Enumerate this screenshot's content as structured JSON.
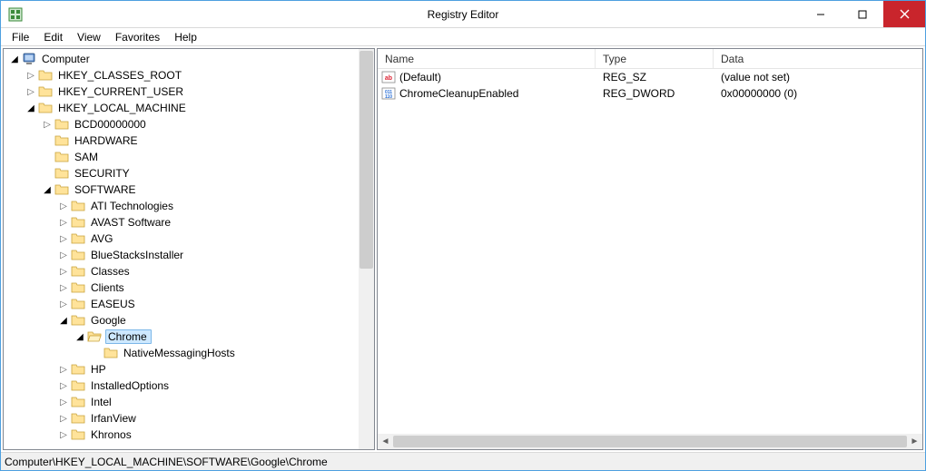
{
  "window": {
    "title": "Registry Editor"
  },
  "menu": {
    "file": "File",
    "edit": "Edit",
    "view": "View",
    "favorites": "Favorites",
    "help": "Help"
  },
  "tree": [
    {
      "level": 0,
      "exp": "open",
      "icon": "computer",
      "label": "Computer"
    },
    {
      "level": 1,
      "exp": "closed",
      "icon": "folder",
      "label": "HKEY_CLASSES_ROOT"
    },
    {
      "level": 1,
      "exp": "closed",
      "icon": "folder",
      "label": "HKEY_CURRENT_USER"
    },
    {
      "level": 1,
      "exp": "open",
      "icon": "folder",
      "label": "HKEY_LOCAL_MACHINE"
    },
    {
      "level": 2,
      "exp": "closed",
      "icon": "folder",
      "label": "BCD00000000"
    },
    {
      "level": 2,
      "exp": "none",
      "icon": "folder",
      "label": "HARDWARE"
    },
    {
      "level": 2,
      "exp": "none",
      "icon": "folder",
      "label": "SAM"
    },
    {
      "level": 2,
      "exp": "none",
      "icon": "folder",
      "label": "SECURITY"
    },
    {
      "level": 2,
      "exp": "open",
      "icon": "folder",
      "label": "SOFTWARE"
    },
    {
      "level": 3,
      "exp": "closed",
      "icon": "folder",
      "label": "ATI Technologies"
    },
    {
      "level": 3,
      "exp": "closed",
      "icon": "folder",
      "label": "AVAST Software"
    },
    {
      "level": 3,
      "exp": "closed",
      "icon": "folder",
      "label": "AVG"
    },
    {
      "level": 3,
      "exp": "closed",
      "icon": "folder",
      "label": "BlueStacksInstaller"
    },
    {
      "level": 3,
      "exp": "closed",
      "icon": "folder",
      "label": "Classes"
    },
    {
      "level": 3,
      "exp": "closed",
      "icon": "folder",
      "label": "Clients"
    },
    {
      "level": 3,
      "exp": "closed",
      "icon": "folder",
      "label": "EASEUS"
    },
    {
      "level": 3,
      "exp": "open",
      "icon": "folder",
      "label": "Google"
    },
    {
      "level": 4,
      "exp": "open",
      "icon": "folder-open",
      "label": "Chrome",
      "selected": true
    },
    {
      "level": 5,
      "exp": "none",
      "icon": "folder",
      "label": "NativeMessagingHosts"
    },
    {
      "level": 3,
      "exp": "closed",
      "icon": "folder",
      "label": "HP"
    },
    {
      "level": 3,
      "exp": "closed",
      "icon": "folder",
      "label": "InstalledOptions"
    },
    {
      "level": 3,
      "exp": "closed",
      "icon": "folder",
      "label": "Intel"
    },
    {
      "level": 3,
      "exp": "closed",
      "icon": "folder",
      "label": "IrfanView"
    },
    {
      "level": 3,
      "exp": "closed",
      "icon": "folder",
      "label": "Khronos"
    }
  ],
  "list": {
    "headers": {
      "name": "Name",
      "type": "Type",
      "data": "Data"
    },
    "rows": [
      {
        "icon": "reg-sz",
        "name": "(Default)",
        "type": "REG_SZ",
        "data": "(value not set)"
      },
      {
        "icon": "reg-dword",
        "name": "ChromeCleanupEnabled",
        "type": "REG_DWORD",
        "data": "0x00000000 (0)"
      }
    ]
  },
  "status": {
    "path": "Computer\\HKEY_LOCAL_MACHINE\\SOFTWARE\\Google\\Chrome"
  }
}
